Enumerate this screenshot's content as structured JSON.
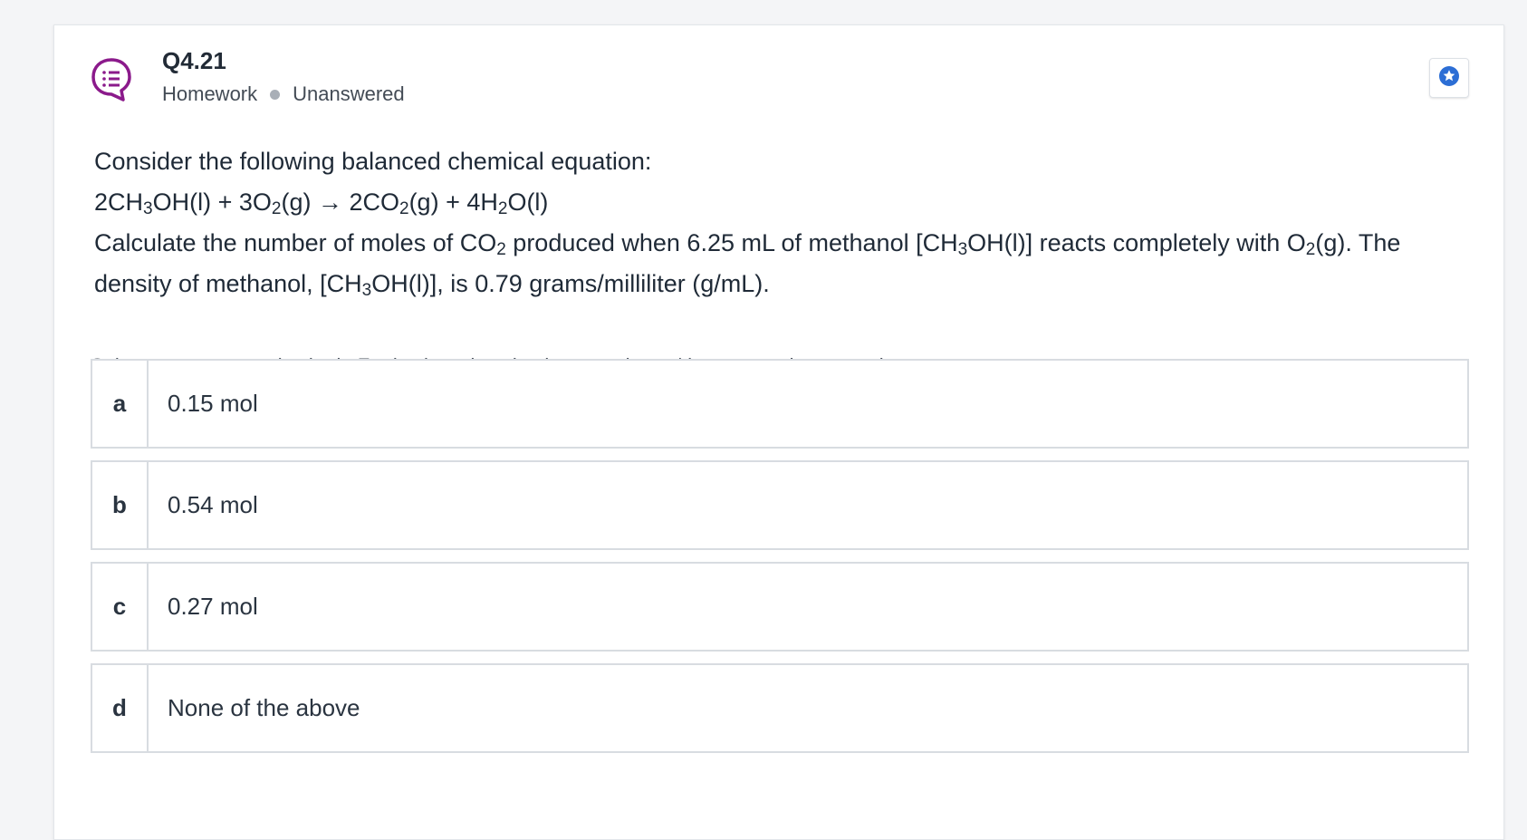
{
  "header": {
    "question_number": "Q4.21",
    "category": "Homework",
    "status": "Unanswered",
    "icon": "multiple-choice-icon",
    "bookmark_icon": "star-icon",
    "accent_color": "#8b1a8b",
    "bookmark_color": "#2c6ed5"
  },
  "question": {
    "intro": "Consider the following balanced chemical equation:",
    "equation": {
      "p1": "2CH",
      "s1": "3",
      "p2": "OH(l) + 3O",
      "s2": "2",
      "p3": "(g) → 2CO",
      "s3": "2",
      "p4": "(g) + 4H",
      "s4": "2",
      "p5": "O(l)"
    },
    "prompt": {
      "p1": "Calculate the number of moles of CO",
      "s1": "2",
      "p2": " produced when 6.25 mL of methanol [CH",
      "s2": "3",
      "p3": "OH(l)] reacts completely with O",
      "s3": "2",
      "p4": "(g). The density of methanol, [CH",
      "s4": "3",
      "p5": "OH(l)], is 0.79 grams/milliliter (g/mL)."
    }
  },
  "instructions": "Select an answer and submit. For keyboard navigation, use the up/down arrow keys to select an answer.",
  "options": [
    {
      "letter": "a",
      "text": "0.15 mol"
    },
    {
      "letter": "b",
      "text": "0.54 mol"
    },
    {
      "letter": "c",
      "text": "0.27 mol"
    },
    {
      "letter": "d",
      "text": "None of the above"
    }
  ]
}
